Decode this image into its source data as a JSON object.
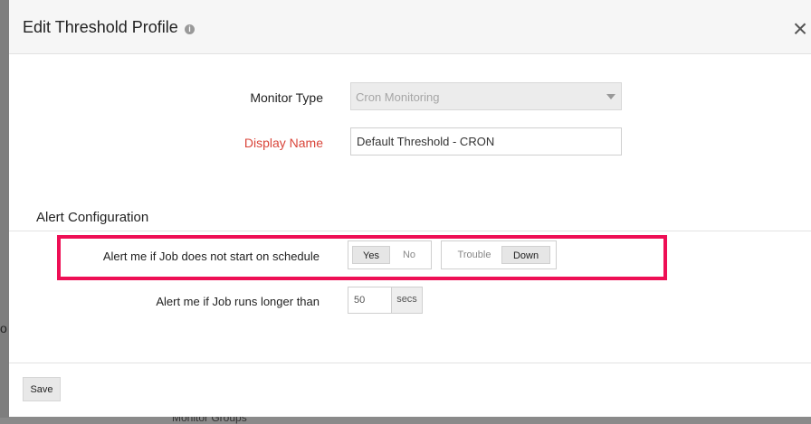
{
  "background": {
    "edge_glyph": "o",
    "bottom_text": "Monitor Groups"
  },
  "modal": {
    "title": "Edit Threshold Profile",
    "info_icon": "info-circle-icon",
    "close_icon": "close-icon",
    "close_glyph": "×"
  },
  "form": {
    "monitor_type": {
      "label": "Monitor Type",
      "value": "Cron Monitoring"
    },
    "display_name": {
      "label": "Display Name",
      "value": "Default Threshold - CRON",
      "label_color": "#d9453a"
    }
  },
  "alert_configuration": {
    "title": "Alert Configuration",
    "schedule_alert": {
      "label": "Alert me if Job does not start on schedule",
      "options": [
        "Yes",
        "No"
      ],
      "selected": "Yes",
      "severity_options": [
        "Trouble",
        "Down"
      ],
      "severity_selected": "Down"
    },
    "runtime_alert": {
      "label": "Alert me if Job runs longer than",
      "value": "50",
      "unit": "secs"
    },
    "highlight_color": "#ee0f55"
  },
  "footer": {
    "save_label": "Save"
  }
}
